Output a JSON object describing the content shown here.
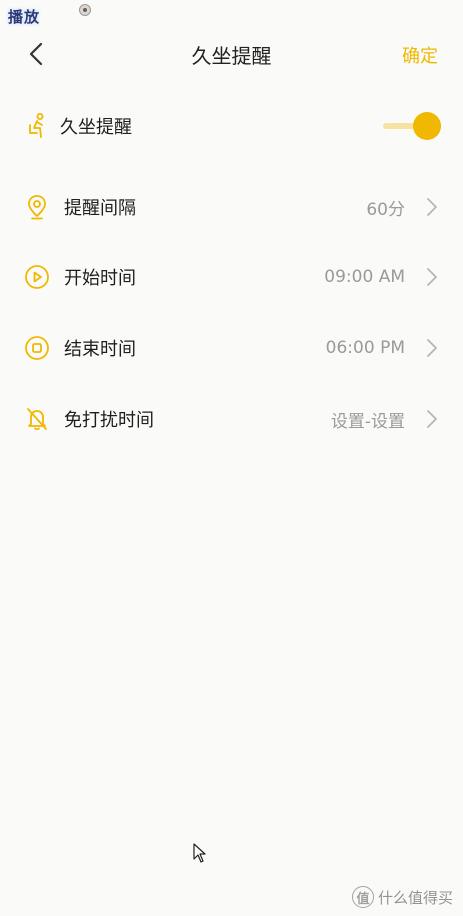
{
  "status": {
    "play_label": "播放"
  },
  "header": {
    "title": "久坐提醒",
    "confirm": "确定"
  },
  "main_toggle": {
    "label": "久坐提醒",
    "enabled": true
  },
  "settings": [
    {
      "icon": "location-pin-icon",
      "label": "提醒间隔",
      "value": "60分"
    },
    {
      "icon": "play-circle-icon",
      "label": "开始时间",
      "value": "09:00 AM"
    },
    {
      "icon": "stop-circle-icon",
      "label": "结束时间",
      "value": "06:00 PM"
    },
    {
      "icon": "bell-off-icon",
      "label": "免打扰时间",
      "value": "设置-设置"
    }
  ],
  "watermark": {
    "logo": "值",
    "text": "什么值得买"
  },
  "colors": {
    "accent": "#f0b800",
    "accent_light": "#f6e3a3",
    "background": "#fafbf8",
    "value_text": "#9a9a9a"
  }
}
